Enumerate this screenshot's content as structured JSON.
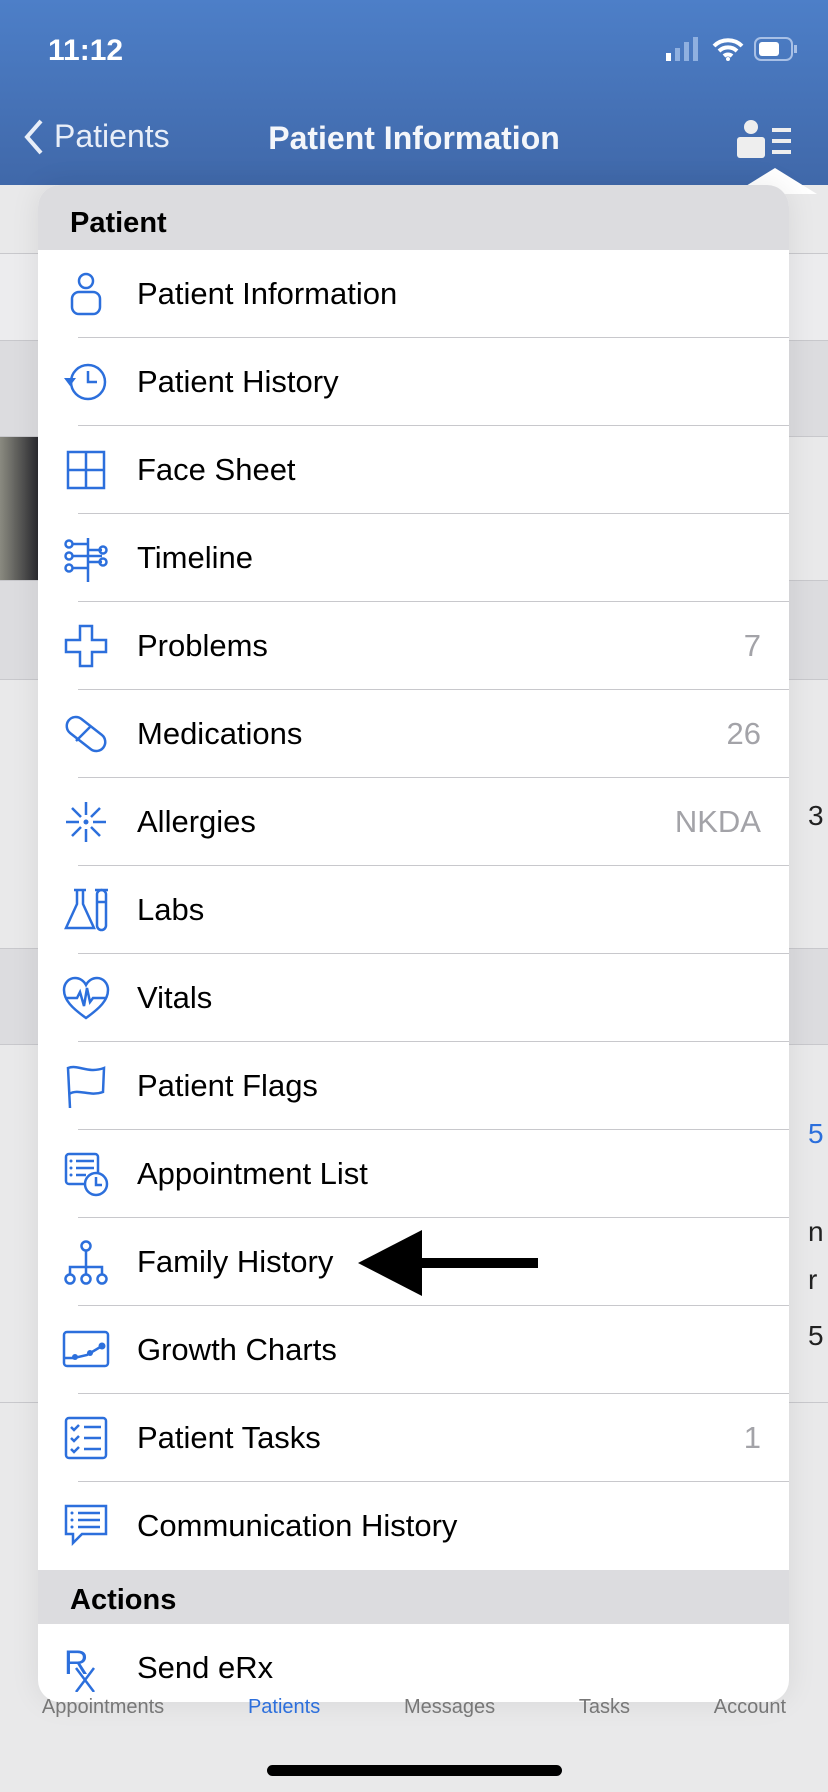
{
  "status_bar": {
    "time": "11:12"
  },
  "nav": {
    "back_label": "Patients",
    "title": "Patient Information"
  },
  "menu": {
    "patient_section": "Patient",
    "items": [
      {
        "label": "Patient Information",
        "icon": "person-icon",
        "count": ""
      },
      {
        "label": "Patient History",
        "icon": "history-clock-icon",
        "count": ""
      },
      {
        "label": "Face Sheet",
        "icon": "grid-icon",
        "count": ""
      },
      {
        "label": "Timeline",
        "icon": "timeline-icon",
        "count": ""
      },
      {
        "label": "Problems",
        "icon": "medical-cross-icon",
        "count": "7"
      },
      {
        "label": "Medications",
        "icon": "pill-icon",
        "count": "26"
      },
      {
        "label": "Allergies",
        "icon": "allergy-burst-icon",
        "count": "NKDA"
      },
      {
        "label": "Labs",
        "icon": "lab-flask-icon",
        "count": ""
      },
      {
        "label": "Vitals",
        "icon": "heart-pulse-icon",
        "count": ""
      },
      {
        "label": "Patient Flags",
        "icon": "flag-icon",
        "count": ""
      },
      {
        "label": "Appointment List",
        "icon": "appointment-list-icon",
        "count": ""
      },
      {
        "label": "Family History",
        "icon": "family-tree-icon",
        "count": ""
      },
      {
        "label": "Growth Charts",
        "icon": "growth-chart-icon",
        "count": ""
      },
      {
        "label": "Patient Tasks",
        "icon": "checklist-icon",
        "count": "1"
      },
      {
        "label": "Communication History",
        "icon": "chat-list-icon",
        "count": ""
      }
    ],
    "actions_section": "Actions",
    "actions": [
      {
        "label": "Send eRx",
        "icon": "rx-icon"
      }
    ]
  },
  "tabbar": {
    "items": [
      "Appointments",
      "Patients",
      "Messages",
      "Tasks",
      "Account"
    ],
    "active": "Patients"
  },
  "colors": {
    "nav": "#4a79c0",
    "icon": "#2c6fdc",
    "active_tab": "#2c6fdc"
  }
}
